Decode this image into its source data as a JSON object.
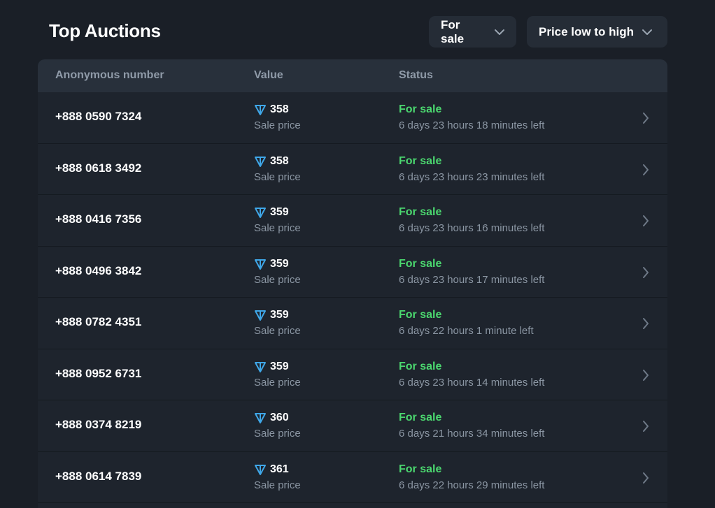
{
  "header": {
    "title": "Top Auctions",
    "filter_label": "For sale",
    "sort_label": "Price low to high"
  },
  "table": {
    "columns": [
      "Anonymous number",
      "Value",
      "Status"
    ],
    "rows": [
      {
        "number": "+888 0590 7324",
        "value": "358",
        "value_sub": "Sale price",
        "status": "For sale",
        "time_left": "6 days 23 hours 18 minutes left"
      },
      {
        "number": "+888 0618 3492",
        "value": "358",
        "value_sub": "Sale price",
        "status": "For sale",
        "time_left": "6 days 23 hours 23 minutes left"
      },
      {
        "number": "+888 0416 7356",
        "value": "359",
        "value_sub": "Sale price",
        "status": "For sale",
        "time_left": "6 days 23 hours 16 minutes left"
      },
      {
        "number": "+888 0496 3842",
        "value": "359",
        "value_sub": "Sale price",
        "status": "For sale",
        "time_left": "6 days 23 hours 17 minutes left"
      },
      {
        "number": "+888 0782 4351",
        "value": "359",
        "value_sub": "Sale price",
        "status": "For sale",
        "time_left": "6 days 22 hours 1 minute left"
      },
      {
        "number": "+888 0952 6731",
        "value": "359",
        "value_sub": "Sale price",
        "status": "For sale",
        "time_left": "6 days 23 hours 14 minutes left"
      },
      {
        "number": "+888 0374 8219",
        "value": "360",
        "value_sub": "Sale price",
        "status": "For sale",
        "time_left": "6 days 21 hours 34 minutes left"
      },
      {
        "number": "+888 0614 7839",
        "value": "361",
        "value_sub": "Sale price",
        "status": "For sale",
        "time_left": "6 days 22 hours 29 minutes left"
      }
    ]
  },
  "icons": {
    "currency": "ton-diamond-icon",
    "dropdown": "chevron-down-icon",
    "row_arrow": "chevron-right-icon"
  },
  "colors": {
    "background": "#1a1f27",
    "header_bg": "#28303b",
    "status_green": "#4bd76f",
    "ton_blue": "#3fa7e8"
  }
}
